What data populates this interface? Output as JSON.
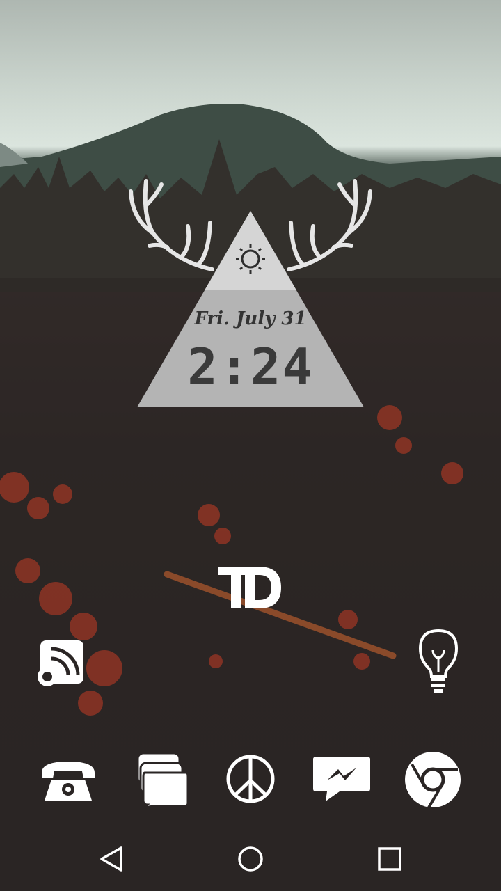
{
  "widget": {
    "date": "Fri. July 31",
    "time": "2:24",
    "weather_icon": "sun-icon",
    "decoration": "antlers-icon"
  },
  "home_icons": [
    {
      "name": "td-bank-app",
      "glyph": "TD"
    },
    {
      "name": "rss-feed-app",
      "icon": "rss-icon"
    },
    {
      "name": "lightbulb-app",
      "icon": "lightbulb-icon"
    }
  ],
  "dock": [
    {
      "name": "phone-app",
      "icon": "phone-icon"
    },
    {
      "name": "messages-app",
      "icon": "chat-icon"
    },
    {
      "name": "peace-app",
      "icon": "peace-icon"
    },
    {
      "name": "messenger-app",
      "icon": "messenger-icon"
    },
    {
      "name": "chrome-app",
      "icon": "chrome-icon"
    }
  ],
  "navbar": {
    "back": "back-icon",
    "home": "home-icon",
    "recents": "recents-icon"
  },
  "colors": {
    "icon": "#ffffff",
    "widget_top": "#d2d2d2",
    "widget_bottom": "#b3b3b3",
    "sky": "#d6e0d9",
    "foliage_red": "#a63a26"
  }
}
